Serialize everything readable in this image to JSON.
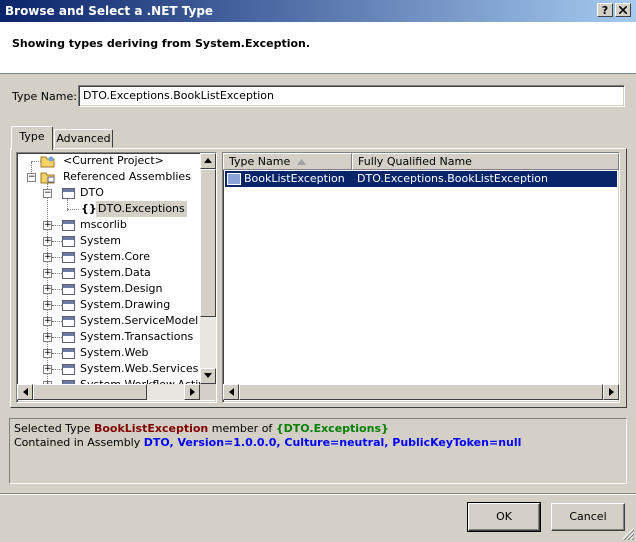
{
  "window": {
    "title": "Browse and Select a .NET Type",
    "help_label": "?",
    "close_label": "X"
  },
  "header": {
    "text": "Showing types deriving from System.Exception."
  },
  "type_name": {
    "label": "Type Name:",
    "value": "DTO.Exceptions.BookListException"
  },
  "tabs": [
    {
      "label": "Type"
    },
    {
      "label": "Advanced"
    }
  ],
  "tree": {
    "current_project": "<Current Project>",
    "referenced_assemblies": "Referenced Assemblies",
    "dto": "DTO",
    "dto_exceptions": "DTO.Exceptions",
    "namespace_icon": "{}",
    "assemblies": [
      "mscorlib",
      "System",
      "System.Core",
      "System.Data",
      "System.Design",
      "System.Drawing",
      "System.ServiceModel",
      "System.Transactions",
      "System.Web",
      "System.Web.Services",
      "System.Workflow.Activiti"
    ]
  },
  "list": {
    "columns": [
      "Type Name",
      "Fully Qualified Name"
    ],
    "rows": [
      {
        "type_name": "BookListException",
        "qualified_name": "DTO.Exceptions.BookListException"
      }
    ]
  },
  "info": {
    "selected_prefix": "Selected Type",
    "selected_type": "BookListException",
    "member_of": "member of",
    "namespace": "{DTO.Exceptions}",
    "contained_prefix": "Contained in Assembly",
    "assembly": "DTO, Version=1.0.0.0, Culture=neutral, PublicKeyToken=null"
  },
  "buttons": {
    "ok": "OK",
    "cancel": "Cancel"
  },
  "colors": {
    "selection": "#0a246a",
    "type_red": "#800000",
    "namespace_green": "#008000",
    "assembly_blue": "#0000ff"
  }
}
